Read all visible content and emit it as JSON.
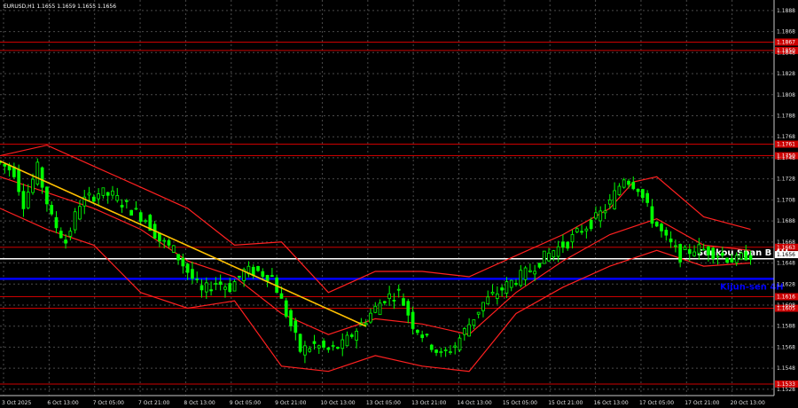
{
  "header": {
    "symbol_text": "EURUSD,H1  1.1655 1.1659 1.1655 1.1656"
  },
  "colors": {
    "background": "#000000",
    "candle_up": "#00ff00",
    "candle_down": "#00ff00",
    "ichimoku_bands": "#ff2020",
    "trend_line": "#ffc000",
    "support_resistance": "#cc0000",
    "senkou_line": "#ffffff",
    "kijun_line": "#0000ff"
  },
  "chart_data": {
    "type": "candlestick",
    "symbol": "EURUSD",
    "timeframe": "H1",
    "ylim": [
      1.1522,
      1.1898
    ],
    "y_ticks": [
      "1.1888",
      "1.1868",
      "1.1848",
      "1.1828",
      "1.1808",
      "1.1788",
      "1.1768",
      "1.1748",
      "1.1728",
      "1.1708",
      "1.1688",
      "1.1668",
      "1.1648",
      "1.1628",
      "1.1608",
      "1.1588",
      "1.1568",
      "1.1548",
      "1.1528"
    ],
    "x_ticks": [
      "3 Oct 2025",
      "6 Oct 13:00",
      "7 Oct 05:00",
      "7 Oct 21:00",
      "8 Oct 13:00",
      "9 Oct 05:00",
      "9 Oct 21:00",
      "10 Oct 13:00",
      "13 Oct 05:00",
      "13 Oct 21:00",
      "14 Oct 13:00",
      "15 Oct 05:00",
      "15 Oct 21:00",
      "16 Oct 13:00",
      "17 Oct 05:00",
      "17 Oct 21:00",
      "20 Oct 13:00"
    ],
    "price_path": [
      [
        0,
        1.1745
      ],
      [
        4,
        1.1735
      ],
      [
        6,
        1.1705
      ],
      [
        9,
        1.1738
      ],
      [
        12,
        1.169
      ],
      [
        15,
        1.1668
      ],
      [
        18,
        1.1705
      ],
      [
        22,
        1.1715
      ],
      [
        25,
        1.1712
      ],
      [
        28,
        1.1702
      ],
      [
        32,
        1.169
      ],
      [
        35,
        1.167
      ],
      [
        38,
        1.166
      ],
      [
        41,
        1.164
      ],
      [
        44,
        1.162
      ],
      [
        47,
        1.163
      ],
      [
        50,
        1.1625
      ],
      [
        53,
        1.164
      ],
      [
        56,
        1.164
      ],
      [
        59,
        1.1635
      ],
      [
        62,
        1.16
      ],
      [
        65,
        1.1565
      ],
      [
        68,
        1.157
      ],
      [
        71,
        1.1565
      ],
      [
        74,
        1.157
      ],
      [
        77,
        1.1585
      ],
      [
        80,
        1.16
      ],
      [
        83,
        1.1615
      ],
      [
        86,
        1.162
      ],
      [
        89,
        1.159
      ],
      [
        92,
        1.1575
      ],
      [
        95,
        1.156
      ],
      [
        98,
        1.157
      ],
      [
        101,
        1.159
      ],
      [
        104,
        1.161
      ],
      [
        107,
        1.162
      ],
      [
        110,
        1.163
      ],
      [
        113,
        1.1638
      ],
      [
        116,
        1.165
      ],
      [
        119,
        1.166
      ],
      [
        122,
        1.1668
      ],
      [
        125,
        1.168
      ],
      [
        128,
        1.169
      ],
      [
        131,
        1.1705
      ],
      [
        134,
        1.173
      ],
      [
        137,
        1.172
      ],
      [
        140,
        1.169
      ],
      [
        143,
        1.167
      ],
      [
        146,
        1.1655
      ],
      [
        149,
        1.1662
      ],
      [
        152,
        1.166
      ],
      [
        155,
        1.1655
      ],
      [
        158,
        1.165
      ],
      [
        160,
        1.1656
      ]
    ],
    "trend_line": [
      [
        0,
        1.1745
      ],
      [
        78,
        1.1588
      ]
    ],
    "ichimoku_upper": [
      [
        0,
        1.175
      ],
      [
        10,
        1.176
      ],
      [
        20,
        1.174
      ],
      [
        30,
        1.172
      ],
      [
        40,
        1.17
      ],
      [
        50,
        1.1665
      ],
      [
        60,
        1.1668
      ],
      [
        70,
        1.162
      ],
      [
        80,
        1.164
      ],
      [
        90,
        1.164
      ],
      [
        100,
        1.1635
      ],
      [
        110,
        1.1655
      ],
      [
        120,
        1.1675
      ],
      [
        130,
        1.17
      ],
      [
        135,
        1.1725
      ],
      [
        140,
        1.173
      ],
      [
        150,
        1.1692
      ],
      [
        160,
        1.168
      ]
    ],
    "ichimoku_lower": [
      [
        0,
        1.17
      ],
      [
        10,
        1.168
      ],
      [
        20,
        1.1665
      ],
      [
        30,
        1.162
      ],
      [
        40,
        1.1605
      ],
      [
        50,
        1.1612
      ],
      [
        60,
        1.155
      ],
      [
        70,
        1.1545
      ],
      [
        80,
        1.156
      ],
      [
        90,
        1.155
      ],
      [
        100,
        1.1545
      ],
      [
        110,
        1.16
      ],
      [
        120,
        1.1625
      ],
      [
        130,
        1.1645
      ],
      [
        140,
        1.166
      ],
      [
        150,
        1.1645
      ],
      [
        160,
        1.1648
      ]
    ],
    "ichimoku_mid": [
      [
        0,
        1.173
      ],
      [
        10,
        1.1715
      ],
      [
        20,
        1.17
      ],
      [
        30,
        1.168
      ],
      [
        40,
        1.165
      ],
      [
        50,
        1.1635
      ],
      [
        60,
        1.16
      ],
      [
        70,
        1.158
      ],
      [
        80,
        1.1595
      ],
      [
        90,
        1.159
      ],
      [
        100,
        1.158
      ],
      [
        110,
        1.162
      ],
      [
        120,
        1.165
      ],
      [
        130,
        1.1675
      ],
      [
        140,
        1.169
      ],
      [
        150,
        1.1665
      ],
      [
        160,
        1.166
      ]
    ],
    "horizontal_levels": [
      {
        "price": 1.1858,
        "label": "1.1867",
        "color": "#cc0000"
      },
      {
        "price": 1.185,
        "label": "1.1850",
        "color": "#cc0000"
      },
      {
        "price": 1.1761,
        "label": "1.1761",
        "color": "#cc0000"
      },
      {
        "price": 1.175,
        "label": "1.1750",
        "color": "#cc0000"
      },
      {
        "price": 1.1663,
        "label": "1.1663",
        "color": "#cc0000"
      },
      {
        "price": 1.1616,
        "label": "1.1616",
        "color": "#cc0000"
      },
      {
        "price": 1.1605,
        "label": "1.1605",
        "color": "#cc0000"
      },
      {
        "price": 1.1533,
        "label": "1.1533",
        "color": "#cc0000"
      }
    ],
    "senkou_span_b_4h": {
      "price": 1.1652,
      "label": "Senkou Span B 4H",
      "color": "#ffffff"
    },
    "kijun_sen_4h": {
      "price": 1.1633,
      "label": "Kijun-sen 4H",
      "color": "#0000ff"
    },
    "current_price": {
      "price": 1.1656,
      "label": "1.1656"
    }
  }
}
